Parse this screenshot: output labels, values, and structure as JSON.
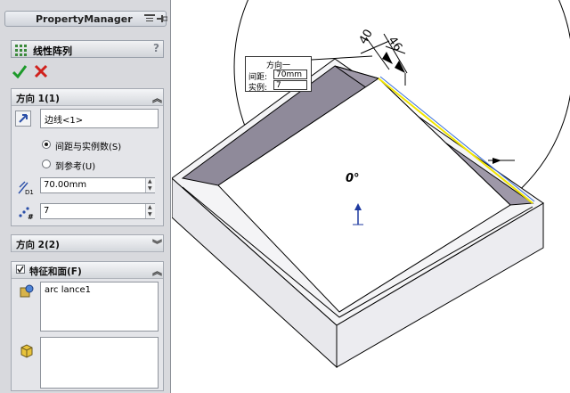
{
  "property_manager": {
    "title": "PropertyManager",
    "feature_title": "线性阵列",
    "help": "?",
    "direction1": {
      "header": "方向 1(1)",
      "edge_field": "边线<1>",
      "radio_spacing": "间距与实例数(S)",
      "radio_reference": "到参考(U)",
      "selected_radio": "间距与实例数(S)",
      "spacing_value": "70.00mm",
      "spacing_unit_label": "D1",
      "instances_value": "7",
      "instances_symbol": "#"
    },
    "direction2": {
      "header": "方向 2(2)"
    },
    "features": {
      "header": "特征和面(F)",
      "checked": true,
      "list_items": [
        "arc lance1"
      ],
      "faces_list": []
    }
  },
  "viewport": {
    "callout": {
      "title": "方向一",
      "spacing_label": "间距:",
      "spacing_value": "70mm",
      "instances_label": "实例:",
      "instances_value": "7"
    },
    "angle_label": "0°",
    "dim1": "40",
    "dim2": "46"
  },
  "colors": {
    "panel_bg": "#d8d9dd",
    "ok_green": "#1d9a2a",
    "cancel_red": "#d0211c",
    "wall_face": "#8f8a9a",
    "outer_face": "#e4e4e8",
    "highlight_edge": "#f2e600"
  }
}
